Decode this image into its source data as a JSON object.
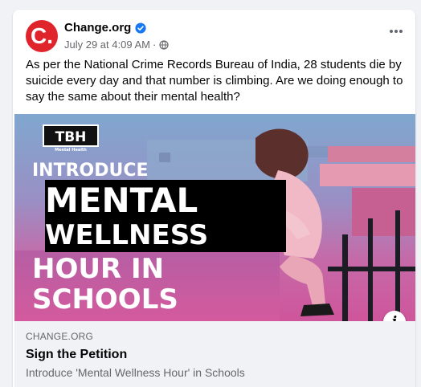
{
  "post": {
    "author": "Change.org",
    "avatar_glyph": "C.",
    "timestamp": "July 29 at 4:09 AM",
    "separator": "·",
    "body": "As per the National Crime Records Bureau of India, 28 students die by suicide every day and that number is climbing. Are we doing enough to say the same about their mental health?"
  },
  "link_preview": {
    "image": {
      "badge": "TBH",
      "badge_sub": "Mental Health",
      "line1": "INTRODUCE",
      "line2": "MENTAL",
      "line3": "WELLNESS",
      "line4": "HOUR IN",
      "line5": "SCHOOLS"
    },
    "info_glyph": "i",
    "domain": "CHANGE.ORG",
    "title": "Sign the Petition",
    "description": "Introduce 'Mental Wellness Hour' in Schools"
  },
  "colors": {
    "brand_red": "#e0242b",
    "verified_blue": "#1877f2",
    "image_pink": "#c9579b",
    "image_blue": "#86a6c9"
  },
  "icons": {
    "verified": "verified-badge-icon",
    "audience": "globe-icon",
    "menu": "more-options-icon",
    "info": "info-icon"
  }
}
